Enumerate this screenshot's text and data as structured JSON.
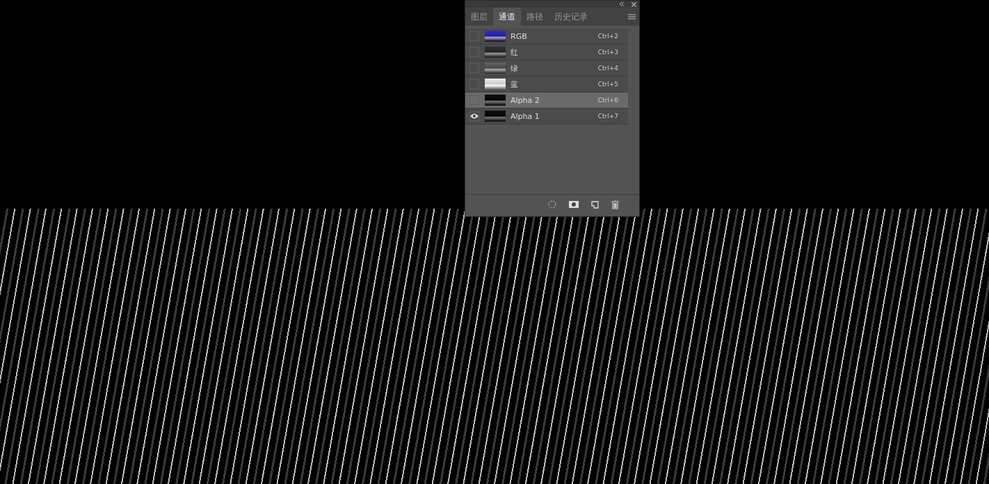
{
  "panel": {
    "tabs": [
      {
        "label": "图层",
        "selected": false
      },
      {
        "label": "通道",
        "selected": true
      },
      {
        "label": "路径",
        "selected": false
      },
      {
        "label": "历史记录",
        "selected": false
      }
    ],
    "channels": [
      {
        "name": "RGB",
        "shortcut": "Ctrl+2",
        "visible": false,
        "selected": false
      },
      {
        "name": "红",
        "shortcut": "Ctrl+3",
        "visible": false,
        "selected": false
      },
      {
        "name": "绿",
        "shortcut": "Ctrl+4",
        "visible": false,
        "selected": false
      },
      {
        "name": "蓝",
        "shortcut": "Ctrl+5",
        "visible": false,
        "selected": false
      },
      {
        "name": "Alpha 2",
        "shortcut": "Ctrl+6",
        "visible": false,
        "selected": true
      },
      {
        "name": "Alpha 1",
        "shortcut": "Ctrl+7",
        "visible": true,
        "selected": false
      }
    ]
  }
}
